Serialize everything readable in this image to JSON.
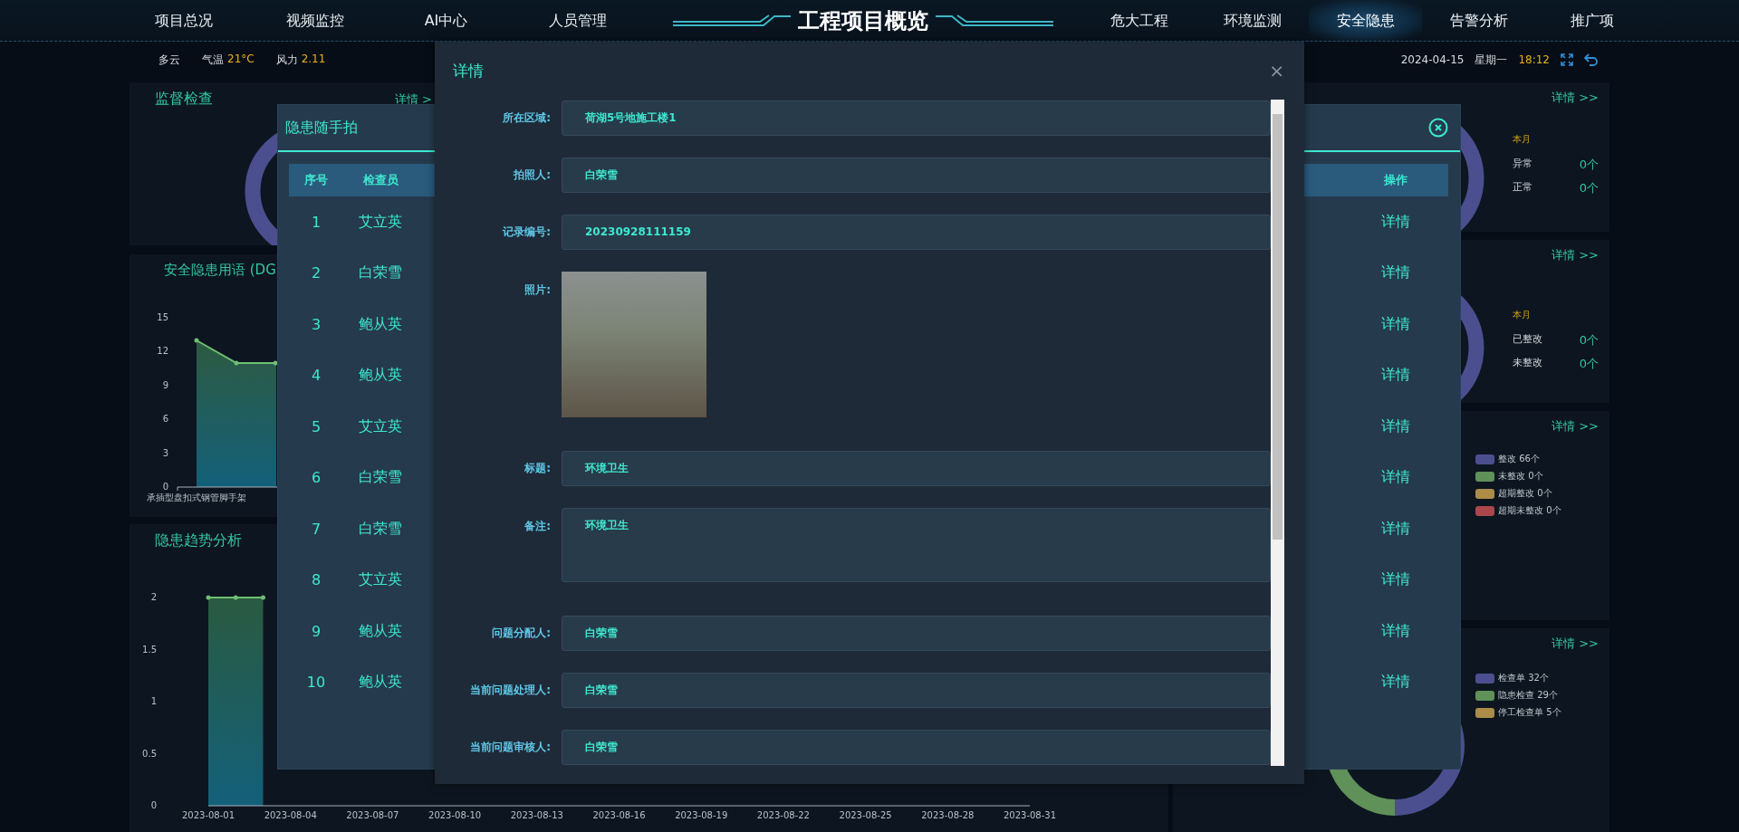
{
  "nav": {
    "left": [
      {
        "label": "项目总况",
        "selected": false
      },
      {
        "label": "视频监控",
        "selected": false
      },
      {
        "label": "AI中心",
        "selected": false
      },
      {
        "label": "人员管理",
        "selected": false
      }
    ],
    "title": "工程项目概览",
    "right": [
      {
        "label": "危大工程",
        "selected": false
      },
      {
        "label": "环境监测",
        "selected": false
      },
      {
        "label": "安全隐患",
        "selected": true
      },
      {
        "label": "告警分析",
        "selected": false
      },
      {
        "label": "推广项",
        "selected": false
      }
    ]
  },
  "info_bar": {
    "weather": "多云",
    "temperature_label": "气温",
    "temperature": "21°C",
    "wind_label": "风力",
    "wind": "2.11",
    "date": "2024-04-15",
    "weekday": "星期一",
    "time": "18:12"
  },
  "left_panels": {
    "inspection": {
      "title": "监督检查",
      "link": "详情 >"
    },
    "hazard_terms": {
      "title": "安全隐患用语 (DG",
      "axis_labels": [
        "15",
        "12",
        "9",
        "6",
        "3",
        "0"
      ],
      "category_label": "承插型盘扣式钢管脚手架"
    },
    "trend": {
      "title": "隐患趋势分析",
      "chart_data": {
        "type": "area",
        "x": [
          "2023-08-01",
          "2023-08-02",
          "2023-08-03"
        ],
        "xticks": [
          "2023-08-01",
          "2023-08-04",
          "2023-08-07",
          "2023-08-10",
          "2023-08-13",
          "2023-08-16",
          "2023-08-19",
          "2023-08-22",
          "2023-08-25",
          "2023-08-28",
          "2023-08-31"
        ],
        "xlim": [
          "2023-08-01",
          "2023-08-31"
        ],
        "series": [
          {
            "color": "#6fbf73",
            "values": [
              2,
              2,
              2
            ]
          }
        ],
        "yticks": [
          {
            "value": 0,
            "label": "0"
          },
          {
            "value": 0.5,
            "label": "0.5"
          },
          {
            "value": 1,
            "label": "1"
          },
          {
            "value": 1.5,
            "label": "1.5"
          },
          {
            "value": 2,
            "label": "2"
          }
        ],
        "ylim": [
          0,
          2
        ]
      }
    }
  },
  "right_panels": [
    {
      "kind": "stats",
      "link": "详情 >>",
      "period": "本月",
      "stats": [
        {
          "label": "异常",
          "value": "0个"
        },
        {
          "label": "正常",
          "value": "0个"
        }
      ]
    },
    {
      "kind": "stats",
      "link": "详情 >>",
      "period": "本月",
      "stats": [
        {
          "label": "已整改",
          "value": "0个"
        },
        {
          "label": "未整改",
          "value": "0个"
        }
      ]
    },
    {
      "kind": "legend",
      "link": "详情 >>",
      "legend": [
        {
          "label": "整改 66个",
          "color": "#4b4f8f"
        },
        {
          "label": "未整改 0个",
          "color": "#5f9158"
        },
        {
          "label": "超期整改 0个",
          "color": "#ab8c49"
        },
        {
          "label": "超期未整改 0个",
          "color": "#ab464b"
        }
      ]
    },
    {
      "kind": "legend-donut",
      "link": "详情 >>",
      "legend": [
        {
          "label": "检查单 32个",
          "color": "#4b4f8f"
        },
        {
          "label": "隐患检查 29个",
          "color": "#5f9158"
        },
        {
          "label": "停工检查单 5个",
          "color": "#ab8c49"
        }
      ]
    }
  ],
  "snapshot_dialog": {
    "title": "隐患随手拍",
    "columns": [
      "序号",
      "检查员",
      "操作"
    ],
    "rows": [
      {
        "index": "1",
        "inspector": "艾立英",
        "action": "详情"
      },
      {
        "index": "2",
        "inspector": "白荣雪",
        "action": "详情"
      },
      {
        "index": "3",
        "inspector": "鲍从英",
        "action": "详情"
      },
      {
        "index": "4",
        "inspector": "鲍从英",
        "action": "详情"
      },
      {
        "index": "5",
        "inspector": "艾立英",
        "action": "详情"
      },
      {
        "index": "6",
        "inspector": "白荣雪",
        "action": "详情"
      },
      {
        "index": "7",
        "inspector": "白荣雪",
        "action": "详情"
      },
      {
        "index": "8",
        "inspector": "艾立英",
        "action": "详情"
      },
      {
        "index": "9",
        "inspector": "鲍从英",
        "action": "详情"
      },
      {
        "index": "10",
        "inspector": "鲍从英",
        "action": "详情"
      }
    ]
  },
  "detail_dialog": {
    "title": "详情",
    "close": "×",
    "fields": [
      {
        "kind": "text",
        "label": "所在区域:",
        "value": "荷湖5号地施工楼1"
      },
      {
        "kind": "text",
        "label": "拍照人:",
        "value": "白荣雪"
      },
      {
        "kind": "text",
        "label": "记录编号:",
        "value": "20230928111159"
      },
      {
        "kind": "photo",
        "label": "照片:"
      },
      {
        "kind": "text",
        "label": "标题:",
        "value": "环境卫生"
      },
      {
        "kind": "textarea",
        "label": "备注:",
        "value": "环境卫生"
      },
      {
        "kind": "text",
        "label": "问题分配人:",
        "value": "白荣雪"
      },
      {
        "kind": "text",
        "label": "当前问题处理人:",
        "value": "白荣雪"
      },
      {
        "kind": "text",
        "label": "当前问题审核人:",
        "value": "白荣雪"
      }
    ]
  }
}
